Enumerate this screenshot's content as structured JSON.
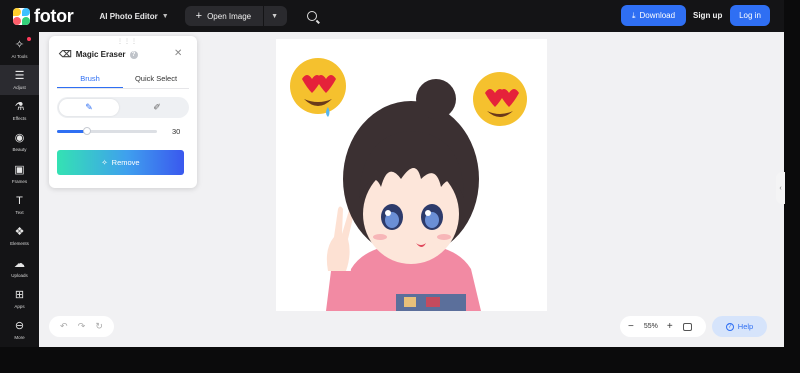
{
  "app": {
    "logo_text": "fotor",
    "brand_colors": [
      "#ffcf2e",
      "#3ec1ff",
      "#ff5f6b",
      "#33d17a"
    ]
  },
  "header": {
    "editor_menu": "AI Photo Editor",
    "open_image": "Open Image",
    "download": "Download",
    "signup": "Sign up",
    "login": "Log in",
    "accent": "#2f6ff3"
  },
  "sidebar": {
    "items": [
      {
        "label": "AI Tools",
        "icon": "magic-wand-icon",
        "glyph": "✧",
        "active": false,
        "badge": true
      },
      {
        "label": "Adjust",
        "icon": "sliders-icon",
        "glyph": "☰",
        "active": true,
        "badge": false
      },
      {
        "label": "Effects",
        "icon": "effects-icon",
        "glyph": "⚗",
        "active": false,
        "badge": false
      },
      {
        "label": "Beauty",
        "icon": "eye-icon",
        "glyph": "◉",
        "active": false,
        "badge": false
      },
      {
        "label": "Frames",
        "icon": "frame-icon",
        "glyph": "▣",
        "active": false,
        "badge": false
      },
      {
        "label": "Text",
        "icon": "text-icon",
        "glyph": "T",
        "active": false,
        "badge": false
      },
      {
        "label": "Elements",
        "icon": "elements-icon",
        "glyph": "❖",
        "active": false,
        "badge": false
      },
      {
        "label": "Uploads",
        "icon": "cloud-upload-icon",
        "glyph": "☁",
        "active": false,
        "badge": false
      },
      {
        "label": "Apps",
        "icon": "apps-icon",
        "glyph": "⊞",
        "active": false,
        "badge": false
      },
      {
        "label": "More",
        "icon": "more-icon",
        "glyph": "⊖",
        "active": false,
        "badge": false
      }
    ]
  },
  "panel": {
    "title": "Magic Eraser",
    "tabs": [
      {
        "label": "Brush",
        "active": true
      },
      {
        "label": "Quick Select",
        "active": false
      }
    ],
    "brush_size": 30,
    "brush_size_fraction": 0.3,
    "remove_label": "Remove"
  },
  "zoom": {
    "value": "55%"
  },
  "help": {
    "label": "Help"
  }
}
